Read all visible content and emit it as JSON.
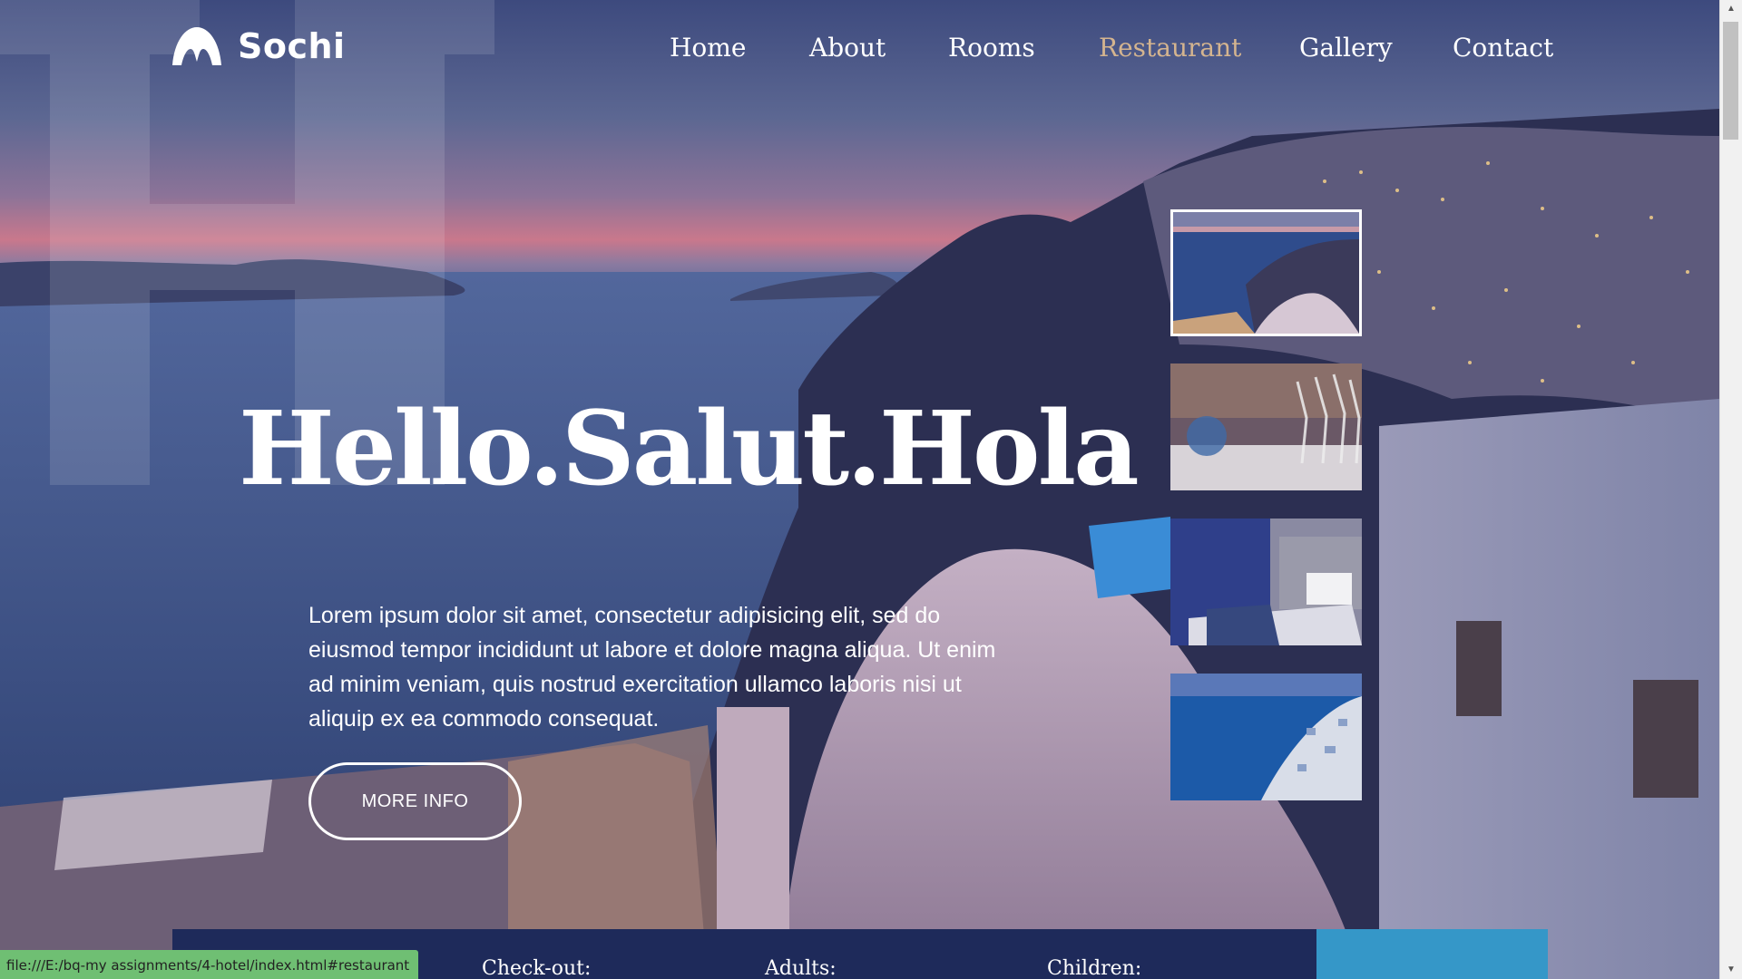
{
  "brand": {
    "name": "Sochi",
    "logo_icon": "mountain-logo-icon"
  },
  "nav": {
    "items": [
      {
        "label": "Home",
        "active": false
      },
      {
        "label": "About",
        "active": false
      },
      {
        "label": "Rooms",
        "active": false
      },
      {
        "label": "Restaurant",
        "active": true
      },
      {
        "label": "Gallery",
        "active": false
      },
      {
        "label": "Contact",
        "active": false
      }
    ],
    "active_color": "#d4b48f"
  },
  "hero": {
    "title": "Hello.Salut.Hola",
    "text": "Lorem ipsum dolor sit amet, consectetur adipisicing elit, sed do eiusmod tempor incididunt ut labore et dolore magna aliqua. Ut enim ad minim veniam, quis nostrud exercitation ullamco laboris nisi ut aliquip ex ea commodo consequat.",
    "button_label": "MORE INFO"
  },
  "thumbnails": [
    {
      "name": "thumb-sunset-view",
      "selected": true
    },
    {
      "name": "thumb-restaurant-glasses",
      "selected": false
    },
    {
      "name": "thumb-hotel-room",
      "selected": false
    },
    {
      "name": "thumb-santorini-coast",
      "selected": false
    }
  ],
  "booking": {
    "checkout_label": "Check-out:",
    "adults_label": "Adults:",
    "children_label": "Children:",
    "bar_color": "#1e2a5a",
    "submit_color": "#3597c8"
  },
  "status_bar": {
    "url": "file:///E:/bq-my assignments/4-hotel/index.html#restaurant"
  }
}
